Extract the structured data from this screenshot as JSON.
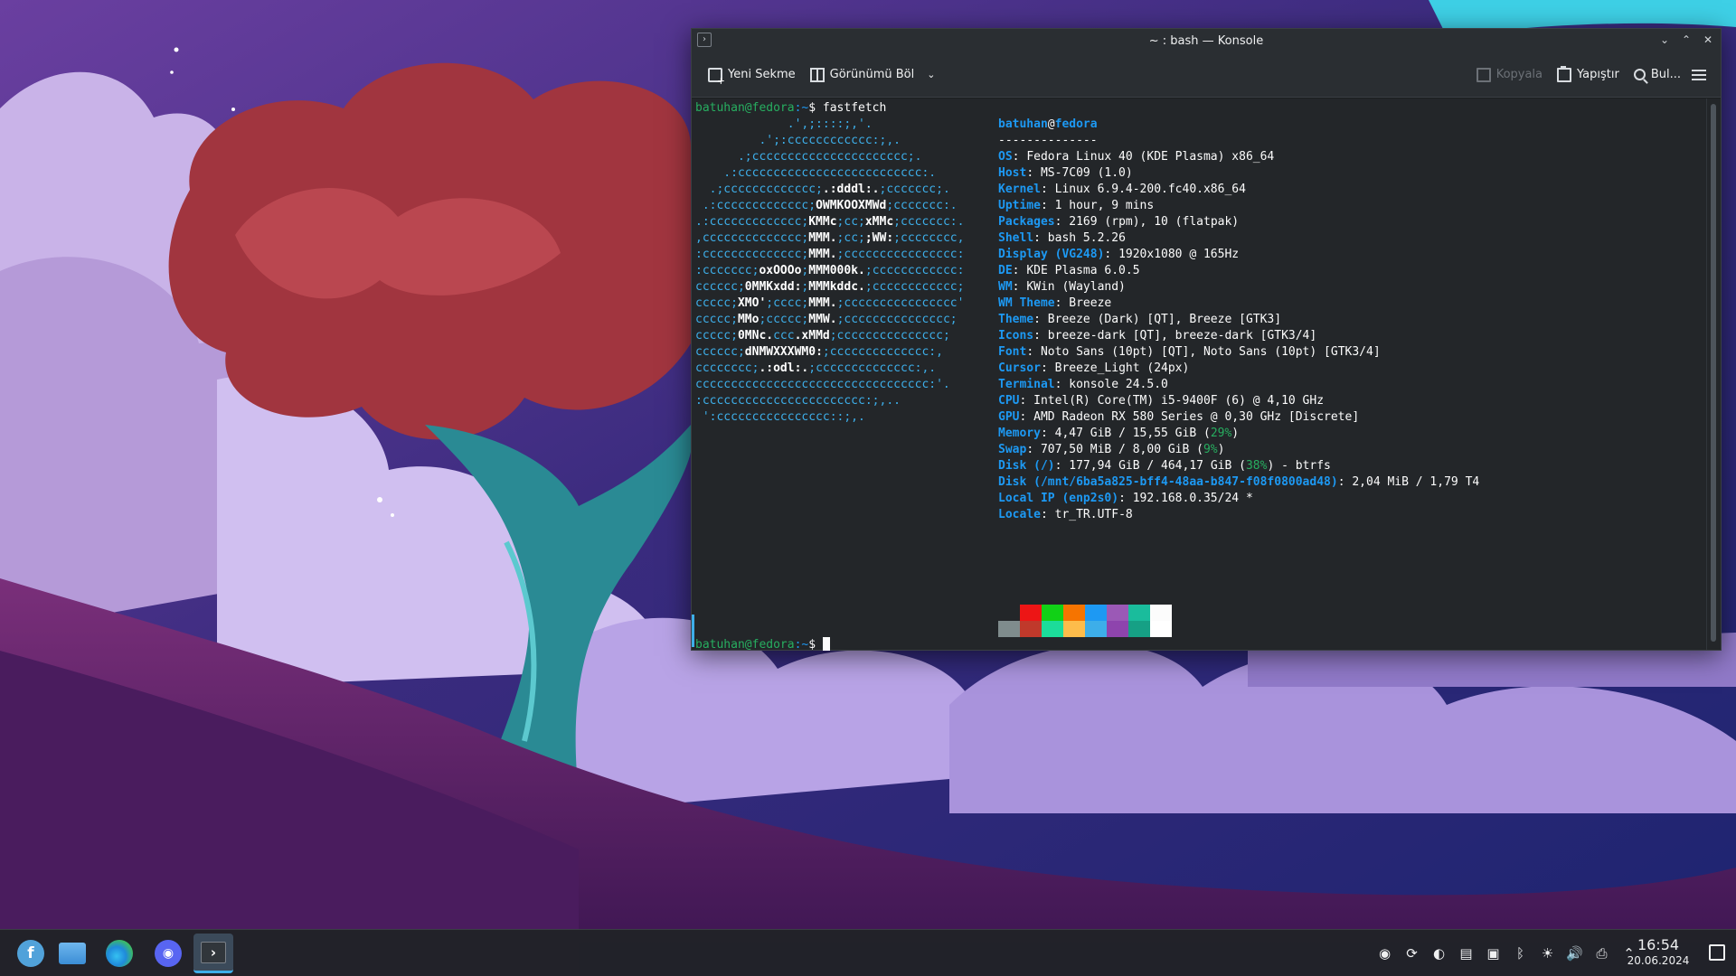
{
  "window": {
    "title": "~ : bash — Konsole",
    "app_icon": "terminal-icon"
  },
  "toolbar": {
    "new_tab": "Yeni Sekme",
    "split_view": "Görünümü Böl",
    "copy": "Kopyala",
    "paste": "Yapıştır",
    "find": "Bul..."
  },
  "terminal": {
    "prompt_user": "batuhan@fedora",
    "prompt_path": ":~",
    "prompt_symbol": "$",
    "command": "fastfetch",
    "logo_lines": [
      [
        [
          "             .',;::::;,'.",
          0
        ]
      ],
      [
        [
          "         .';:cccccccccccc:;,.",
          0
        ]
      ],
      [
        [
          "      .;cccccccccccccccccccccc;.",
          0
        ]
      ],
      [
        [
          "    .:cccccccccccccccccccccccccc:.",
          0
        ]
      ],
      [
        [
          "  .;ccccccccccccc;",
          0
        ],
        [
          ".:dddl:.",
          1
        ],
        [
          ";ccccccc;.",
          0
        ]
      ],
      [
        [
          " .:ccccccccccccc;",
          0
        ],
        [
          "OWMKOOXMWd",
          1
        ],
        [
          ";ccccccc:.",
          0
        ]
      ],
      [
        [
          ".:ccccccccccccc;",
          0
        ],
        [
          "KMMc",
          1
        ],
        [
          ";cc;",
          0
        ],
        [
          "xMMc",
          1
        ],
        [
          ";ccccccc:.",
          0
        ]
      ],
      [
        [
          ",cccccccccccccc;",
          0
        ],
        [
          "MMM.",
          1
        ],
        [
          ";cc;",
          0
        ],
        [
          ";WW:",
          1
        ],
        [
          ";cccccccc,",
          0
        ]
      ],
      [
        [
          ":cccccccccccccc;",
          0
        ],
        [
          "MMM.",
          1
        ],
        [
          ";cccccccccccccccc:",
          0
        ]
      ],
      [
        [
          ":ccccccc;",
          0
        ],
        [
          "oxOOOo",
          1
        ],
        [
          ";",
          0
        ],
        [
          "MMM000k.",
          1
        ],
        [
          ";cccccccccccc:",
          0
        ]
      ],
      [
        [
          "cccccc;",
          0
        ],
        [
          "0MMKxdd:",
          1
        ],
        [
          ";",
          0
        ],
        [
          "MMMkddc.",
          1
        ],
        [
          ";cccccccccccc;",
          0
        ]
      ],
      [
        [
          "ccccc;",
          0
        ],
        [
          "XMO'",
          1
        ],
        [
          ";cccc;",
          0
        ],
        [
          "MMM.",
          1
        ],
        [
          ";cccccccccccccccc'",
          0
        ]
      ],
      [
        [
          "ccccc;",
          0
        ],
        [
          "MMo",
          1
        ],
        [
          ";ccccc;",
          0
        ],
        [
          "MMW.",
          1
        ],
        [
          ";ccccccccccccccc;",
          0
        ]
      ],
      [
        [
          "ccccc;",
          0
        ],
        [
          "0MNc.",
          1
        ],
        [
          "ccc",
          0
        ],
        [
          ".xMMd",
          1
        ],
        [
          ";ccccccccccccccc;",
          0
        ]
      ],
      [
        [
          "cccccc;",
          0
        ],
        [
          "dNMWXXXWM0:",
          1
        ],
        [
          ";cccccccccccccc:,",
          0
        ]
      ],
      [
        [
          "cccccccc;",
          0
        ],
        [
          ".:odl:.",
          1
        ],
        [
          ";cccccccccccccc:,.",
          0
        ]
      ],
      [
        [
          "ccccccccccccccccccccccccccccccccc:'.",
          0
        ]
      ],
      [
        [
          ":ccccccccccccccccccccccc:;,..",
          0
        ]
      ],
      [
        [
          " ':cccccccccccccccc::;,.",
          0
        ]
      ]
    ],
    "info_header": {
      "user": "batuhan",
      "at": "@",
      "host": "fedora",
      "rule": "--------------"
    },
    "info": [
      {
        "key": "OS",
        "val": "Fedora Linux 40 (KDE Plasma) x86_64"
      },
      {
        "key": "Host",
        "val": "MS-7C09 (1.0)"
      },
      {
        "key": "Kernel",
        "val": "Linux 6.9.4-200.fc40.x86_64"
      },
      {
        "key": "Uptime",
        "val": "1 hour, 9 mins"
      },
      {
        "key": "Packages",
        "val": "2169 (rpm), 10 (flatpak)"
      },
      {
        "key": "Shell",
        "val": "bash 5.2.26"
      },
      {
        "key": "Display (VG248)",
        "val": "1920x1080 @ 165Hz"
      },
      {
        "key": "DE",
        "val": "KDE Plasma 6.0.5"
      },
      {
        "key": "WM",
        "val": "KWin (Wayland)"
      },
      {
        "key": "WM Theme",
        "val": "Breeze"
      },
      {
        "key": "Theme",
        "val": "Breeze (Dark) [QT], Breeze [GTK3]"
      },
      {
        "key": "Icons",
        "val": "breeze-dark [QT], breeze-dark [GTK3/4]"
      },
      {
        "key": "Font",
        "val": "Noto Sans (10pt) [QT], Noto Sans (10pt) [GTK3/4]"
      },
      {
        "key": "Cursor",
        "val": "Breeze_Light (24px)"
      },
      {
        "key": "Terminal",
        "val": "konsole 24.5.0"
      },
      {
        "key": "CPU",
        "val": "Intel(R) Core(TM) i5-9400F (6) @ 4,10 GHz"
      },
      {
        "key": "GPU",
        "val": "AMD Radeon RX 580 Series @ 0,30 GHz [Discrete]"
      },
      {
        "key": "Memory",
        "val": "4,47 GiB / 15,55 GiB (",
        "pct": "29%",
        "tail": ")"
      },
      {
        "key": "Swap",
        "val": "707,50 MiB / 8,00 GiB (",
        "pct": "9%",
        "tail": ")"
      },
      {
        "key": "Disk (/)",
        "val": "177,94 GiB / 464,17 GiB (",
        "pct": "38%",
        "tail": ") - btrfs"
      },
      {
        "key": "Disk (/mnt/6ba5a825-bff4-48aa-b847-f08f0800ad48)",
        "val": "2,04 MiB / 1,79 T4"
      },
      {
        "key": "Local IP (enp2s0)",
        "val": "192.168.0.35/24 *"
      },
      {
        "key": "Locale",
        "val": "tr_TR.UTF-8"
      }
    ],
    "palette_top": [
      "#232629",
      "#ed1515",
      "#11d116",
      "#f67400",
      "#1d99f3",
      "#9b59b6",
      "#1abc9c",
      "#fcfcfc"
    ],
    "palette_bottom": [
      "#7f8c8d",
      "#c0392b",
      "#1cdc9a",
      "#fdbc4b",
      "#3daee9",
      "#8e44ad",
      "#16a085",
      "#ffffff"
    ]
  },
  "taskbar": {
    "apps": [
      {
        "name": "fedora-launcher-icon",
        "glyph": "f"
      },
      {
        "name": "dolphin-files-icon",
        "glyph": ""
      },
      {
        "name": "edge-browser-icon",
        "glyph": ""
      },
      {
        "name": "discord-icon",
        "glyph": "◉"
      },
      {
        "name": "konsole-icon",
        "glyph": "›"
      }
    ],
    "tray": [
      {
        "name": "discord-tray-icon",
        "glyph": "◉"
      },
      {
        "name": "updates-tray-icon",
        "glyph": "⟳"
      },
      {
        "name": "steam-tray-icon",
        "glyph": "◐"
      },
      {
        "name": "clipboard-tray-icon",
        "glyph": "▤"
      },
      {
        "name": "network-tray-icon",
        "glyph": "▣"
      },
      {
        "name": "bluetooth-tray-icon",
        "glyph": "ᛒ"
      },
      {
        "name": "brightness-tray-icon",
        "glyph": "☀"
      },
      {
        "name": "volume-tray-icon",
        "glyph": "🔊"
      },
      {
        "name": "printer-tray-icon",
        "glyph": "⎙"
      },
      {
        "name": "expand-tray-icon",
        "glyph": "⌃"
      }
    ],
    "time": "16:54",
    "date": "20.06.2024"
  }
}
